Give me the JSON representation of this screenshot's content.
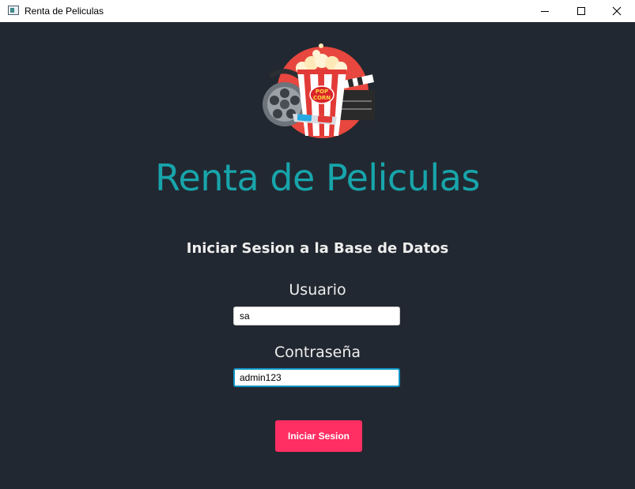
{
  "window": {
    "title": "Renta de Peliculas",
    "minimize_icon": "minimize-icon",
    "maximize_icon": "maximize-icon",
    "close_icon": "close-icon"
  },
  "main": {
    "logo_icon": "popcorn-film-logo",
    "app_title": "Renta de Peliculas",
    "subtitle": "Iniciar Sesion a la Base de Datos",
    "username_label": "Usuario",
    "username_value": "sa",
    "password_label": "Contraseña",
    "password_value": "admin123",
    "login_button": "Iniciar Sesion"
  },
  "colors": {
    "background": "#222831",
    "title": "#17a5ab",
    "button": "#ff2e63",
    "focus_border": "#0e93c5"
  }
}
